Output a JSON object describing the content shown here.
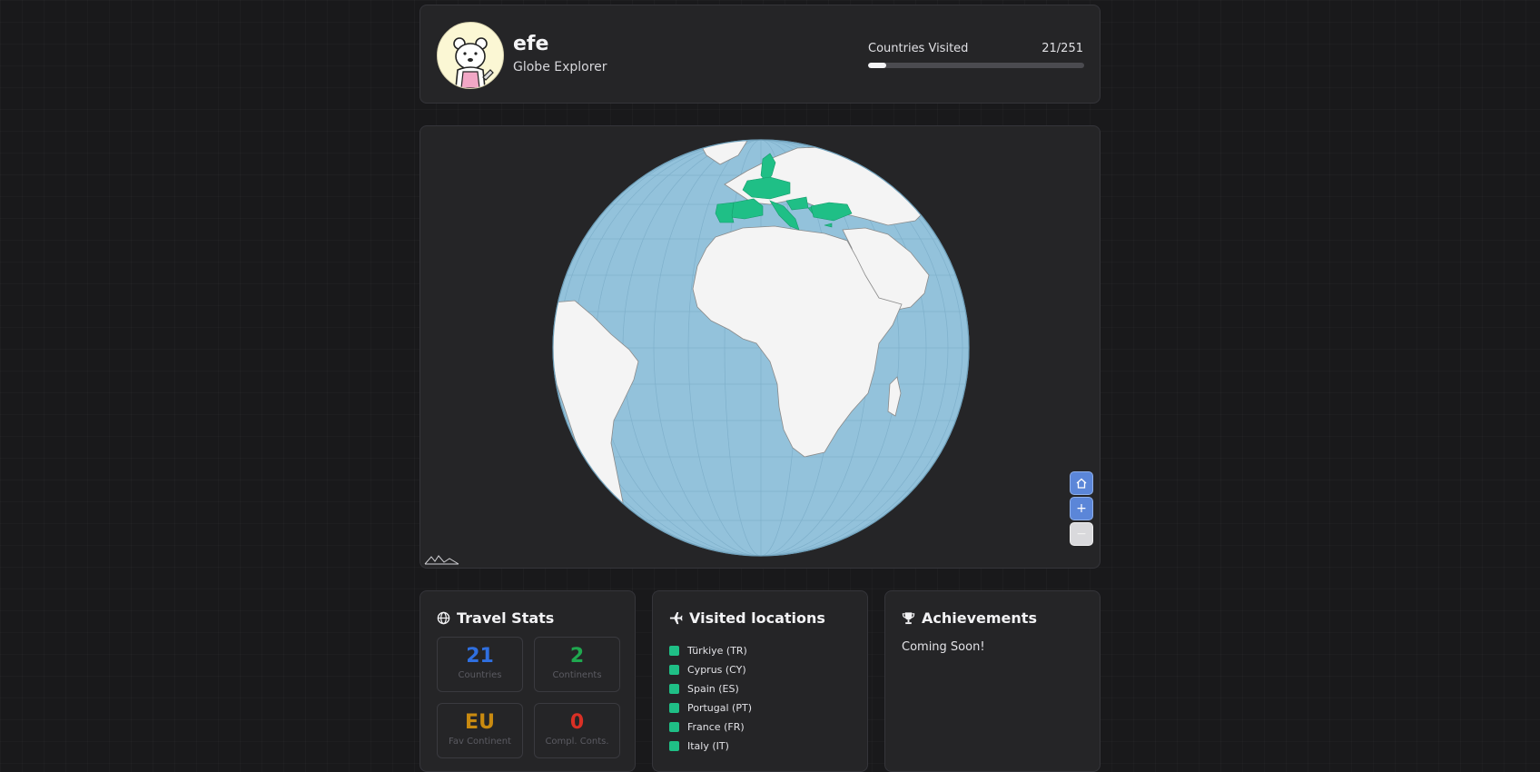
{
  "profile": {
    "username": "efe",
    "title": "Globe Explorer",
    "avatar_icon": "polar-bear-avatar"
  },
  "progress": {
    "label": "Countries Visited",
    "count_text": "21/251",
    "visited": 21,
    "total": 251
  },
  "map": {
    "controls": {
      "home_icon": "home-icon",
      "zoom_in": "+",
      "zoom_out": "−"
    },
    "colors": {
      "ocean": "#93c2db",
      "land": "#f4f4f4",
      "visited": "#1fbf86"
    }
  },
  "stats": {
    "title": "Travel Stats",
    "icon": "globe-icon",
    "boxes": [
      {
        "value": "21",
        "label": "Countries",
        "color": "#2f6fe0"
      },
      {
        "value": "2",
        "label": "Continents",
        "color": "#1fa84f"
      },
      {
        "value": "EU",
        "label": "Fav Continent",
        "color": "#c98a10"
      },
      {
        "value": "0",
        "label": "Compl. Conts.",
        "color": "#d93025"
      }
    ]
  },
  "visited": {
    "title": "Visited locations",
    "icon": "plane-icon",
    "items": [
      "Türkiye (TR)",
      "Cyprus (CY)",
      "Spain (ES)",
      "Portugal (PT)",
      "France (FR)",
      "Italy (IT)"
    ]
  },
  "achievements": {
    "title": "Achievements",
    "icon": "trophy-icon",
    "message": "Coming Soon!"
  }
}
